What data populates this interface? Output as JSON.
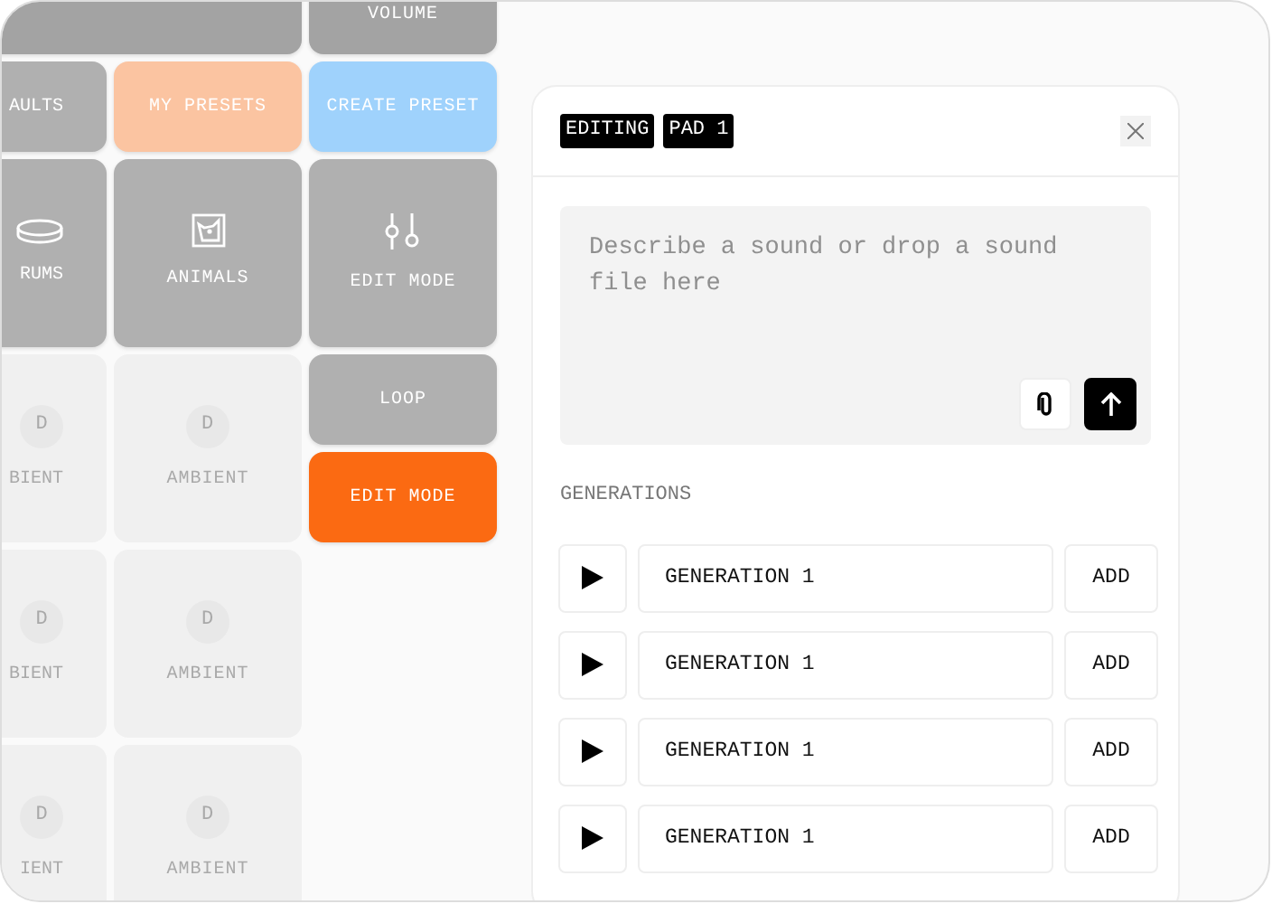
{
  "left_pads": [
    {
      "kind": "wide",
      "color": "#a3a3a3"
    },
    {
      "kind": "button",
      "label": "AULTS",
      "color": "#b0b0b0"
    },
    {
      "kind": "button",
      "label": "MY PRESETS",
      "color": "#fbc4a1"
    },
    {
      "kind": "icon",
      "label": "RUMS",
      "color": "#b0b0b0"
    },
    {
      "kind": "icon",
      "label": "ANIMALS",
      "color": "#b0b0b0"
    },
    {
      "kind": "empty",
      "badge": "D",
      "label": "BIENT",
      "color": "#f0f0f0"
    },
    {
      "kind": "empty",
      "badge": "D",
      "label": "AMBIENT",
      "color": "#f0f0f0"
    },
    {
      "kind": "empty",
      "badge": "D",
      "label": "BIENT",
      "color": "#f0f0f0"
    },
    {
      "kind": "empty",
      "badge": "D",
      "label": "AMBIENT",
      "color": "#f0f0f0"
    },
    {
      "kind": "empty",
      "badge": "D",
      "label": "IENT",
      "color": "#f0f0f0"
    },
    {
      "kind": "empty",
      "badge": "D",
      "label": "AMBIENT",
      "color": "#f0f0f0"
    }
  ],
  "right_pads": [
    {
      "kind": "button",
      "label": "VOLUME",
      "color": "#a3a3a3"
    },
    {
      "kind": "button",
      "label": "CREATE PRESET",
      "color": "#9fd2fc"
    },
    {
      "kind": "icon",
      "label": "EDIT MODE",
      "color": "#b0b0b0"
    },
    {
      "kind": "button",
      "label": "LOOP",
      "color": "#b0b0b0"
    },
    {
      "kind": "button",
      "label": "EDIT MODE",
      "color": "#fb6a12"
    }
  ],
  "panel": {
    "tags": [
      "EDITING",
      "PAD 1"
    ],
    "prompt": {
      "placeholder": "Describe a sound or drop a sound file here"
    },
    "section": "GENERATIONS",
    "generations": [
      {
        "name": "GENERATION 1",
        "action": "ADD"
      },
      {
        "name": "GENERATION 1",
        "action": "ADD"
      },
      {
        "name": "GENERATION 1",
        "action": "ADD"
      },
      {
        "name": "GENERATION 1",
        "action": "ADD"
      }
    ]
  }
}
